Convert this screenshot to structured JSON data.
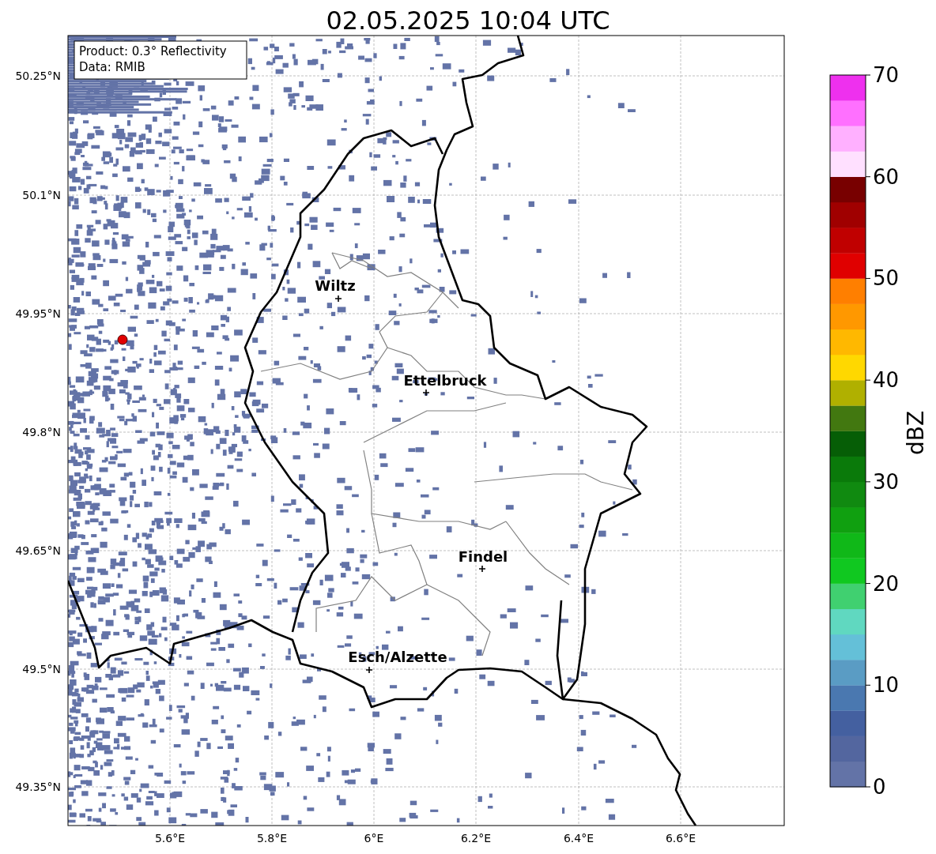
{
  "title": "02.05.2025 10:04 UTC",
  "info_box": [
    "Product: 0.3° Reflectivity",
    "Data: RMIB"
  ],
  "y_ticks": [
    "50.25°N",
    "50.1°N",
    "49.95°N",
    "49.8°N",
    "49.65°N",
    "49.5°N",
    "49.35°N"
  ],
  "x_ticks": [
    "5.6°E",
    "5.8°E",
    "6°E",
    "6.2°E",
    "6.4°E",
    "6.6°E"
  ],
  "cities": [
    {
      "name": "Wiltz"
    },
    {
      "name": "Ettelbruck"
    },
    {
      "name": "Findel"
    },
    {
      "name": "Esch/Alzette"
    }
  ],
  "colorbar": {
    "label": "dBZ",
    "ticks": [
      "70",
      "60",
      "50",
      "40",
      "30",
      "20",
      "10",
      "0"
    ],
    "bands": [
      {
        "color": "#6373a7"
      },
      {
        "color": "#53669f"
      },
      {
        "color": "#4460a0"
      },
      {
        "color": "#4a78b0"
      },
      {
        "color": "#5a9cc4"
      },
      {
        "color": "#64c0d8"
      },
      {
        "color": "#60d8c0"
      },
      {
        "color": "#40d070"
      },
      {
        "color": "#10c820"
      },
      {
        "color": "#10b818"
      },
      {
        "color": "#10a010"
      },
      {
        "color": "#108a10"
      },
      {
        "color": "#0a7a0a"
      },
      {
        "color": "#065e06"
      },
      {
        "color": "#427810"
      },
      {
        "color": "#b0b000"
      },
      {
        "color": "#ffd800"
      },
      {
        "color": "#ffb800"
      },
      {
        "color": "#ff9800"
      },
      {
        "color": "#ff7f00"
      },
      {
        "color": "#e00000"
      },
      {
        "color": "#c00000"
      },
      {
        "color": "#a00000"
      },
      {
        "color": "#780000"
      },
      {
        "color": "#ffe0ff"
      },
      {
        "color": "#ffb0ff"
      },
      {
        "color": "#ff70ff"
      },
      {
        "color": "#ee30ee"
      }
    ]
  }
}
